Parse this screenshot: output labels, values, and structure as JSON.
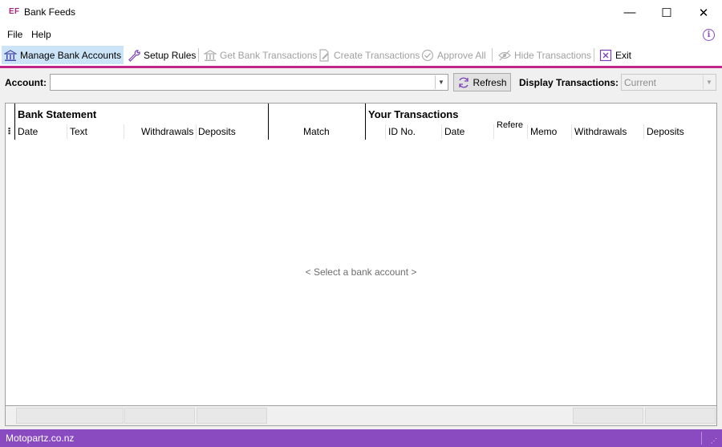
{
  "window": {
    "logo": "EF",
    "title": "Bank Feeds",
    "minimize": "—",
    "maximize": "☐",
    "close": "✕"
  },
  "menu": {
    "file": "File",
    "help": "Help",
    "info": "i"
  },
  "toolbar": {
    "manage": "Manage Bank Accounts",
    "setup": "Setup Rules",
    "get": "Get Bank Transactions",
    "create": "Create Transactions",
    "approve": "Approve All",
    "hide": "Hide Transactions",
    "exit": "Exit"
  },
  "filter": {
    "account_label": "Account:",
    "account_value": "",
    "refresh": "Refresh",
    "display_label": "Display Transactions:",
    "display_value": "Current"
  },
  "grid": {
    "bank_statement": "Bank Statement",
    "your_transactions": "Your Transactions",
    "columns": {
      "date": "Date",
      "text": "Text",
      "withdrawals": "Withdrawals",
      "deposits": "Deposits",
      "match": "Match",
      "id_no": "ID No.",
      "tx_date": "Date",
      "reference": "Refere",
      "memo": "Memo",
      "tx_withdrawals": "Withdrawals",
      "tx_deposits": "Deposits"
    },
    "placeholder": "< Select a bank account >"
  },
  "status": {
    "company": "Motopartz.co.nz"
  },
  "colors": {
    "accent": "#c0268a",
    "status_bar": "#8a4bc1"
  }
}
